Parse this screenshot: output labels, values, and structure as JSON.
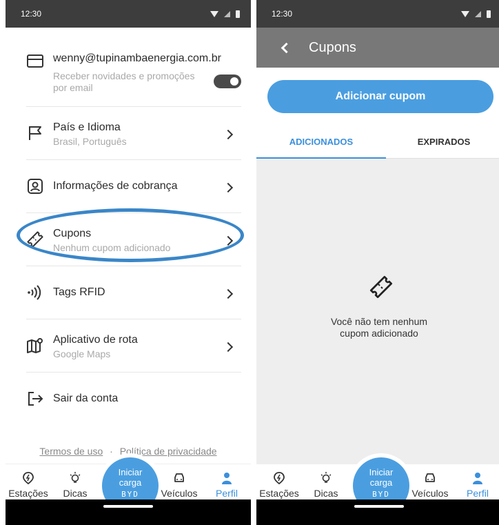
{
  "status_bar": {
    "time": "12:30"
  },
  "profile": {
    "email": "wenny@tupinambaenergia.com.br",
    "email_sub_line1": "Receber novidades e promoções",
    "email_sub_line2": "por email",
    "newsletter_toggle": {
      "on": true
    },
    "items": [
      {
        "title": "País e Idioma",
        "subtitle": "Brasil, Português"
      },
      {
        "title": "Informações de cobrança",
        "subtitle": ""
      },
      {
        "title": "Cupons",
        "subtitle": "Nenhum cupom adicionado"
      },
      {
        "title": "Tags RFID",
        "subtitle": ""
      },
      {
        "title": "Aplicativo de rota",
        "subtitle": "Google Maps"
      },
      {
        "title": "Sair da conta",
        "subtitle": ""
      }
    ],
    "footer": {
      "terms": "Termos de uso",
      "separator": "·",
      "privacy": "Política de privacidade"
    }
  },
  "cupons": {
    "header_title": "Cupons",
    "add_button": "Adicionar cupom",
    "tabs": [
      {
        "label": "ADICIONADOS",
        "active": true
      },
      {
        "label": "EXPIRADOS",
        "active": false
      }
    ],
    "empty_line1": "Você não tem nenhum",
    "empty_line2": "cupom adicionado"
  },
  "bottom_nav": {
    "items": [
      {
        "label": "Estações",
        "icon": "charging-station-icon"
      },
      {
        "label": "Dicas",
        "icon": "lightbulb-icon"
      },
      {
        "label": "Veículos",
        "icon": "car-icon"
      },
      {
        "label": "Perfil",
        "icon": "person-icon",
        "active": true
      }
    ],
    "start_line1": "Iniciar",
    "start_line2": "carga",
    "start_brand": "BYD"
  },
  "colors": {
    "accent": "#4a9ee0",
    "accent_text": "#3b8fdc",
    "header_bg": "#787878",
    "status_bar_bg": "#3d3d3d",
    "highlight_ring": "#3a86c8"
  }
}
